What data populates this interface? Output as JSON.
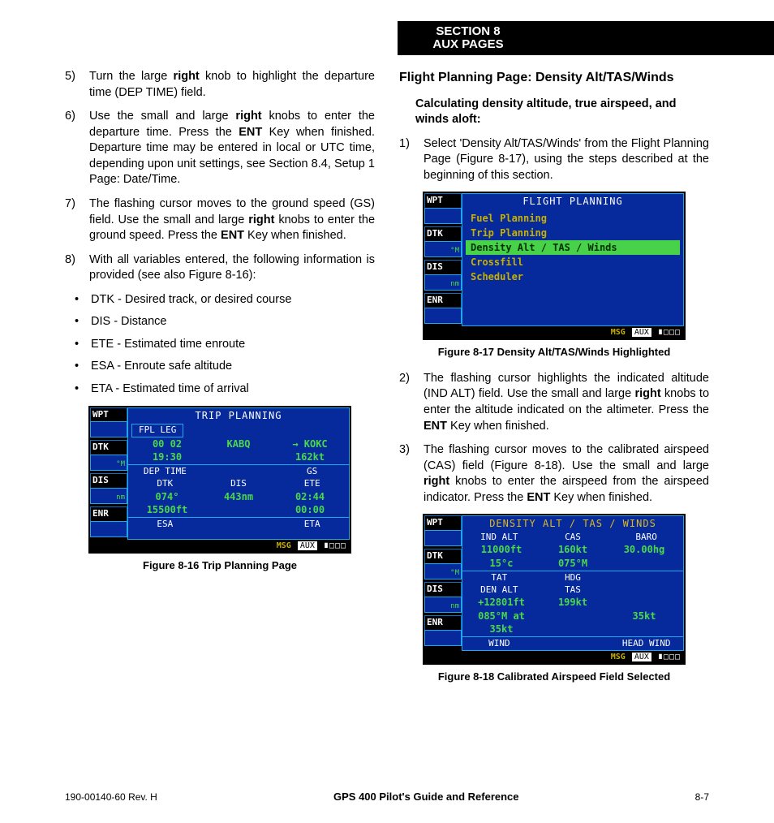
{
  "header": {
    "line1": "SECTION 8",
    "line2": "AUX PAGES"
  },
  "left": {
    "items": [
      {
        "n": "5)",
        "html": "Turn the large <b class='k'>right</b> knob to highlight the departure time (DEP TIME) field."
      },
      {
        "n": "6)",
        "html": "Use the small and large <b class='k'>right</b> knobs to enter the departure time.  Press the <b class='k'>ENT</b> Key when finished.  Departure time may be entered in local or UTC time, depending upon unit settings, see Section 8.4, Setup 1 Page: Date/Time."
      },
      {
        "n": "7)",
        "html": "The flashing cursor moves to the ground speed (GS) field.  Use the small and large <b class='k'>right</b> knobs to enter the ground speed.  Press the <b class='k'>ENT</b> Key when finished."
      },
      {
        "n": "8)",
        "html": "With all variables entered, the following information is provided (see also Figure 8-16):"
      }
    ],
    "bullets": [
      "DTK - Desired track, or desired course",
      "DIS - Distance",
      "ETE - Estimated time enroute",
      "ESA - Enroute safe altitude",
      "ETA - Estimated time of arrival"
    ],
    "fig16_caption": "Figure 8-16  Trip Planning Page"
  },
  "right": {
    "heading": "Flight Planning Page: Density Alt/TAS/Winds",
    "subheading": "Calculating density altitude, true airspeed, and winds aloft:",
    "item1": {
      "n": "1)",
      "html": "Select 'Density Alt/TAS/Winds' from the Flight Planning Page (Figure 8-17), using the steps described at the beginning of this section."
    },
    "fig17_caption": "Figure 8-17  Density Alt/TAS/Winds Highlighted",
    "items_after": [
      {
        "n": "2)",
        "html": "The flashing cursor highlights the indicated altitude (IND ALT) field.  Use the small and large <b class='k'>right</b> knobs to enter the altitude indicated on the altimeter.  Press the <b class='k'>ENT</b> Key when finished."
      },
      {
        "n": "3)",
        "html": "The flashing cursor moves to the calibrated airspeed (CAS) field (Figure 8-18).  Use the small and large <b class='k'>right</b> knobs to enter the airspeed from the airspeed indicator.  Press the <b class='k'>ENT</b> Key when finished."
      }
    ],
    "fig18_caption": "Figure 8-18  Calibrated Airspeed Field Selected"
  },
  "gps_sidebar_labels": [
    "WPT",
    "DTK",
    "DIS",
    "ENR"
  ],
  "gps_sidebar_units": [
    "",
    "°\nM",
    "n\nm",
    ""
  ],
  "fig16": {
    "title": "TRIP PLANNING",
    "tabs": "FPL  LEG",
    "row1": [
      "00  02",
      "KABQ",
      "→ KOKC"
    ],
    "row2": [
      "19:30",
      "",
      "162kt"
    ],
    "hdr1": [
      "DEP TIME",
      "",
      "GS"
    ],
    "hdr2": [
      "DTK",
      "DIS",
      "ETE"
    ],
    "row3": [
      "074°",
      "443nm",
      "02:44"
    ],
    "row4": [
      "15500ft",
      "",
      "00:00"
    ],
    "hdr3": [
      "ESA",
      "",
      "ETA"
    ]
  },
  "fig17": {
    "title": "FLIGHT PLANNING",
    "menu": [
      "Fuel Planning",
      "Trip Planning",
      "Density Alt / TAS / Winds",
      "Crossfill",
      "Scheduler"
    ],
    "selected_index": 2
  },
  "fig18": {
    "title": "DENSITY ALT / TAS / WINDS",
    "hdr1": [
      "IND ALT",
      "CAS",
      "BARO"
    ],
    "row1": [
      "11000ft",
      "160kt",
      "30.00hg"
    ],
    "row2": [
      "15°c",
      "075°M",
      ""
    ],
    "hdr2": [
      "TAT",
      "HDG",
      ""
    ],
    "hdr3": [
      "DEN ALT",
      "TAS",
      ""
    ],
    "row3": [
      "+12801ft",
      "199kt",
      ""
    ],
    "row4": [
      "085°M at 35kt",
      "",
      "35kt"
    ],
    "hdr4": [
      "WIND",
      "",
      "HEAD WIND"
    ]
  },
  "bottom_bar": {
    "msg": "MSG",
    "aux": "AUX",
    "dots": "∎□□□"
  },
  "footer": {
    "left": "190-00140-60  Rev. H",
    "mid": "GPS 400 Pilot's Guide and Reference",
    "right": "8-7"
  }
}
